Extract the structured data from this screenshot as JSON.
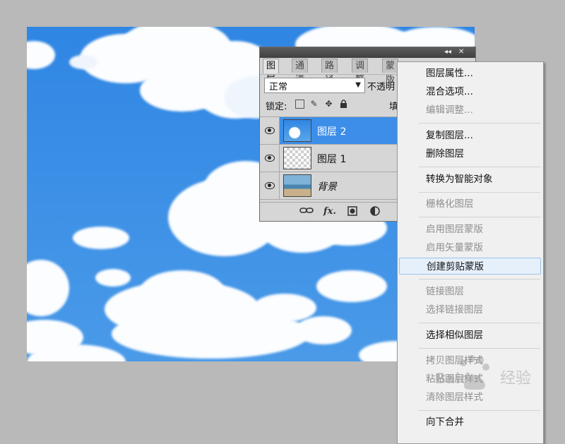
{
  "panel": {
    "tabs": [
      "图层",
      "通道",
      "路径",
      "调整",
      "蒙版"
    ],
    "blend_mode": "正常",
    "opacity_label": "不透明",
    "lock_label": "锁定:",
    "fill_label": "填",
    "layers": [
      {
        "name": "图层 2",
        "selected": true,
        "thumb": "sky"
      },
      {
        "name": "图层 1",
        "selected": false,
        "thumb": "transparent"
      },
      {
        "name": "背景",
        "selected": false,
        "thumb": "photo"
      }
    ],
    "footer_icons": [
      "link-icon",
      "fx-icon",
      "mask-icon",
      "adjustment-icon"
    ],
    "fx_label": "fx."
  },
  "menu": {
    "items": [
      {
        "label": "图层属性...",
        "disabled": false
      },
      {
        "label": "混合选项...",
        "disabled": false
      },
      {
        "label": "编辑调整...",
        "disabled": true
      },
      {
        "label": "复制图层...",
        "disabled": false
      },
      {
        "label": "删除图层",
        "disabled": false
      },
      {
        "label": "转换为智能对象",
        "disabled": false
      },
      {
        "label": "栅格化图层",
        "disabled": true
      },
      {
        "label": "启用图层蒙版",
        "disabled": true
      },
      {
        "label": "启用矢量蒙版",
        "disabled": true
      },
      {
        "label": "创建剪贴蒙版",
        "disabled": false,
        "hover": true
      },
      {
        "label": "链接图层",
        "disabled": true
      },
      {
        "label": "选择链接图层",
        "disabled": true
      },
      {
        "label": "选择相似图层",
        "disabled": false
      },
      {
        "label": "拷贝图层样式",
        "disabled": true
      },
      {
        "label": "粘贴图层样式",
        "disabled": true
      },
      {
        "label": "清除图层样式",
        "disabled": true
      },
      {
        "label": "向下合并",
        "disabled": false
      }
    ]
  },
  "watermark": {
    "text": "经验",
    "brand": "Baidu"
  }
}
